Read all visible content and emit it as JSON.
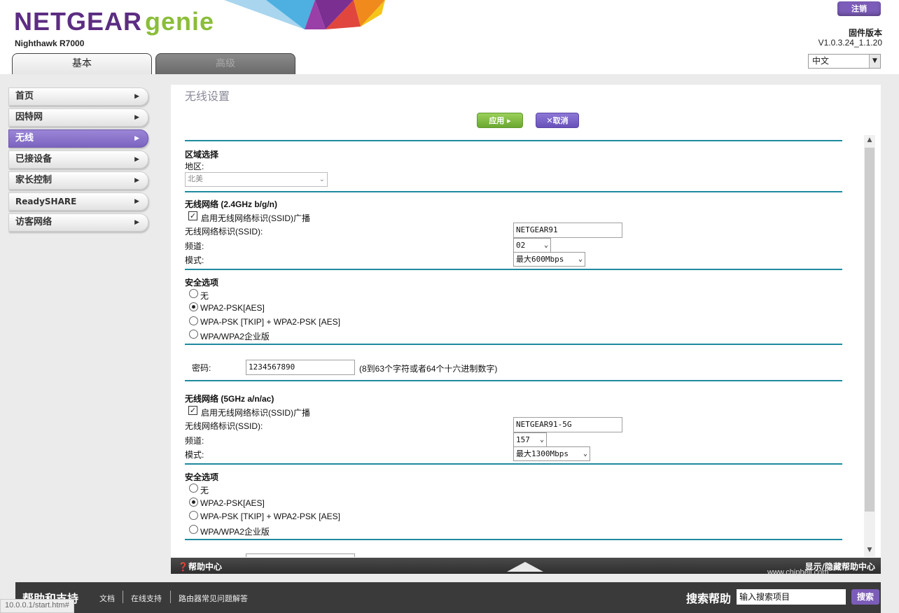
{
  "header": {
    "brand": "NETGEAR",
    "brand_suffix": "genie",
    "model": "Nighthawk R7000",
    "logout_label": "注销",
    "firmware_label": "固件版本",
    "firmware_version": "V1.0.3.24_1.1.20",
    "language": "中文",
    "tabs": [
      {
        "label": "基本",
        "active": true
      },
      {
        "label": "高级",
        "active": false
      }
    ]
  },
  "sidebar": {
    "items": [
      {
        "label": "首页"
      },
      {
        "label": "因特网"
      },
      {
        "label": "无线",
        "active": true
      },
      {
        "label": "已接设备"
      },
      {
        "label": "家长控制"
      },
      {
        "label": "ReadySHARE"
      },
      {
        "label": "访客网络"
      }
    ]
  },
  "page": {
    "title": "无线设置",
    "apply_label": "应用 ▸",
    "cancel_label": "✕取消"
  },
  "region": {
    "heading": "区域选择",
    "label": "地区:",
    "value": "北美"
  },
  "wifi24": {
    "heading": "无线网络 (2.4GHz b/g/n)",
    "broadcast_label": "启用无线网络标识(SSID)广播",
    "ssid_label": "无线网络标识(SSID):",
    "ssid_value": "NETGEAR91",
    "channel_label": "频道:",
    "channel_value": "02",
    "mode_label": "模式:",
    "mode_value": "最大600Mbps",
    "security_heading": "安全选项",
    "security_options": [
      "无",
      "WPA2-PSK[AES]",
      "WPA-PSK [TKIP] + WPA2-PSK [AES]",
      "WPA/WPA2企业版"
    ],
    "security_selected": "WPA2-PSK[AES]",
    "password_label": "密码:",
    "password_value": "1234567890",
    "password_hint": "(8到63个字符或者64个十六进制数字)"
  },
  "wifi5": {
    "heading": "无线网络 (5GHz a/n/ac)",
    "broadcast_label": "启用无线网络标识(SSID)广播",
    "ssid_label": "无线网络标识(SSID):",
    "ssid_value": "NETGEAR91-5G",
    "channel_label": "频道:",
    "channel_value": "157",
    "mode_label": "模式:",
    "mode_value": "最大1300Mbps",
    "security_heading": "安全选项",
    "security_options": [
      "无",
      "WPA2-PSK[AES]",
      "WPA-PSK [TKIP] + WPA2-PSK [AES]",
      "WPA/WPA2企业版"
    ],
    "security_selected": "WPA2-PSK[AES]"
  },
  "helpbar": {
    "title": "帮助中心",
    "toggle": "显示/隐藏帮助中心"
  },
  "footer": {
    "title": "帮助和支持",
    "links": [
      "文档",
      "在线支持",
      "路由器常见问题解答"
    ],
    "search_label": "搜索帮助",
    "search_placeholder": "输入搜索项目",
    "search_button": "搜索"
  },
  "status_url": "10.0.0.1/start.htm#",
  "watermark": "www.chiphell.com",
  "colors": {
    "brand_purple": "#5c2d82",
    "genie_green": "#8bbd3a",
    "accent_purple": "#7b64c0",
    "divider_teal": "#1f8a9e"
  }
}
